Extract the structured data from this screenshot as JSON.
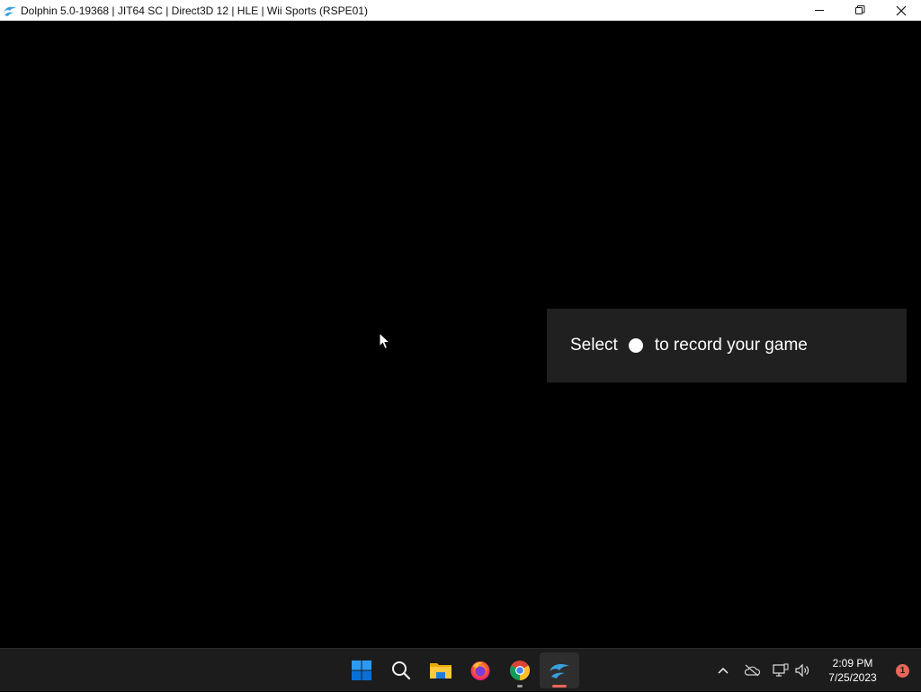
{
  "window": {
    "title": "Dolphin 5.0-19368 | JIT64 SC | Direct3D 12 | HLE | Wii Sports (RSPE01)",
    "app_icon": "dolphin-icon",
    "controls": [
      "minimize-icon",
      "restore-icon",
      "close-icon"
    ]
  },
  "toast": {
    "text_before": "Select",
    "icon": "record-circle-icon",
    "text_after": "to record your game"
  },
  "taskbar": {
    "apps": [
      {
        "name": "Start",
        "icon": "windows-start-icon"
      },
      {
        "name": "Search",
        "icon": "search-icon"
      },
      {
        "name": "File Explorer",
        "icon": "file-explorer-icon"
      },
      {
        "name": "Firefox",
        "icon": "firefox-icon"
      },
      {
        "name": "Chrome",
        "icon": "chrome-icon"
      },
      {
        "name": "Dolphin",
        "icon": "dolphin-icon",
        "active": true
      }
    ],
    "tray": {
      "icons": [
        "chevron-up-icon",
        "onedrive-offline-icon",
        "network-icon",
        "volume-icon"
      ],
      "time": "2:09 PM",
      "date": "7/25/2023",
      "notification_count": "1"
    }
  },
  "colors": {
    "taskbar_bg": "#1c1c1c",
    "toast_bg": "#202020",
    "windows_blue": "#0078d4",
    "dolphin_blue": "#3aa0e0",
    "badge": "#e8655a"
  }
}
